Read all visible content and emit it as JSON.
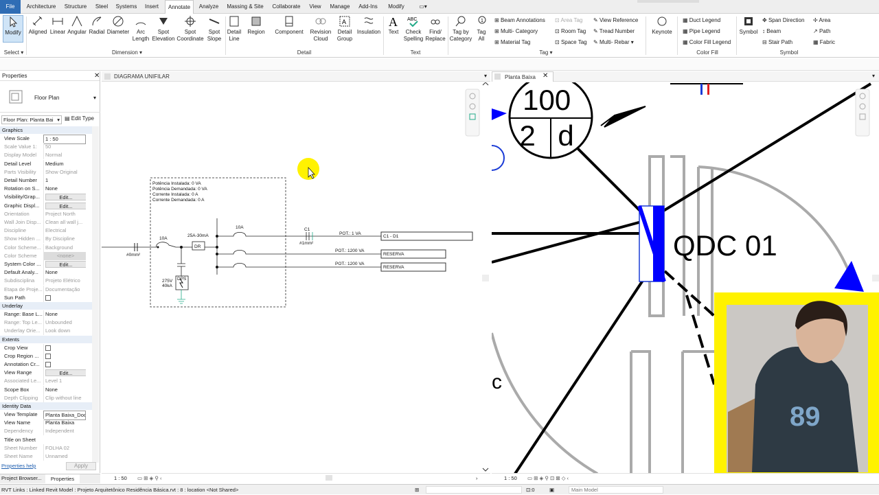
{
  "menu": {
    "file": "File",
    "tabs": [
      "Architecture",
      "Structure",
      "Steel",
      "Systems",
      "Insert",
      "Annotate",
      "Analyze",
      "Massing & Site",
      "Collaborate",
      "View",
      "Manage",
      "Add-Ins",
      "Modify"
    ],
    "active": "Annotate"
  },
  "ribbon": {
    "modify": "Modify",
    "select": "Select",
    "dimension_buttons": [
      "Aligned",
      "Linear",
      "Angular",
      "Radial",
      "Diameter",
      "Arc Length",
      "Spot Elevation",
      "Spot Coordinate",
      "Spot Slope"
    ],
    "dimension_group": "Dimension",
    "detail_buttons": [
      "Detail Line",
      "Region",
      "Component",
      "Revision Cloud",
      "Detail Group",
      "Insulation"
    ],
    "detail_group": "Detail",
    "text_buttons": [
      "Text",
      "Check Spelling",
      "Find/ Replace"
    ],
    "text_group": "Text",
    "tag_buttons": [
      "Tag by Category",
      "Tag All"
    ],
    "tag_small": [
      "Beam Annotations",
      "Multi- Category",
      "Material Tag",
      "Area Tag",
      "Room Tag",
      "Space Tag",
      "View Reference",
      "Tread Number",
      "Multi- Rebar"
    ],
    "tag_group": "Tag",
    "keynote": "Keynote",
    "colorfill_small": [
      "Duct Legend",
      "Pipe Legend",
      "Color Fill Legend"
    ],
    "colorfill_group": "Color Fill",
    "symbol": "Symbol",
    "symbol_small": [
      "Span Direction",
      "Beam",
      "Stair Path",
      "Area",
      "Path",
      "Fabric"
    ],
    "symbol_group": "Symbol"
  },
  "properties": {
    "title": "Properties",
    "type_name": "Floor Plan",
    "instance_selector": "Floor Plan: Planta Bai",
    "edit_type": "Edit Type",
    "categories": [
      "Graphics",
      "Underlay",
      "Extents",
      "Identity Data"
    ],
    "graphics": [
      [
        "View Scale",
        "1 : 50",
        0
      ],
      [
        "Scale Value 1:",
        "50",
        1
      ],
      [
        "Display Model",
        "Normal",
        1
      ],
      [
        "Detail Level",
        "Medium",
        0
      ],
      [
        "Parts Visibility",
        "Show Original",
        1
      ],
      [
        "Detail Number",
        "1",
        0
      ],
      [
        "Rotation on S...",
        "None",
        0
      ],
      [
        "Visibility/Grap...",
        "Edit...",
        0
      ],
      [
        "Graphic Displ...",
        "Edit...",
        0
      ],
      [
        "Orientation",
        "Project North",
        1
      ],
      [
        "Wall Join Disp...",
        "Clean all wall j...",
        1
      ],
      [
        "Discipline",
        "Electrical",
        1
      ],
      [
        "Show Hidden ...",
        "By Discipline",
        1
      ],
      [
        "Color Scheme...",
        "Background",
        1
      ],
      [
        "Color Scheme",
        "<none>",
        1
      ],
      [
        "System Color ...",
        "Edit...",
        0
      ],
      [
        "Default Analy...",
        "None",
        0
      ],
      [
        "Subdisciplina",
        "Projeto Elétrico",
        1
      ],
      [
        "Etapa de Proje...",
        "Documentação",
        1
      ],
      [
        "Sun Path",
        "",
        0
      ]
    ],
    "underlay": [
      [
        "Range: Base L...",
        "None",
        0
      ],
      [
        "Range: Top Le...",
        "Unbounded",
        1
      ],
      [
        "Underlay Orie...",
        "Look down",
        1
      ]
    ],
    "extents": [
      [
        "Crop View",
        "",
        0
      ],
      [
        "Crop Region ...",
        "",
        0
      ],
      [
        "Annotation Cr...",
        "",
        0
      ],
      [
        "View Range",
        "Edit...",
        0
      ],
      [
        "Associated Le...",
        "Level 1",
        1
      ],
      [
        "Scope Box",
        "None",
        0
      ],
      [
        "Depth Clipping",
        "Clip without line",
        1
      ]
    ],
    "identity": [
      [
        "View Template",
        "Planta Baixa_Doc",
        0
      ],
      [
        "View Name",
        "Planta Baixa",
        0
      ],
      [
        "Dependency",
        "Independent",
        1
      ],
      [
        "Title on Sheet",
        "",
        0
      ],
      [
        "Sheet Number",
        "FOLHA 02",
        1
      ],
      [
        "Sheet Name",
        "Unnamed",
        1
      ]
    ],
    "help": "Properties help",
    "apply": "Apply",
    "bottom_tabs": [
      "Project Browser...",
      "Properties"
    ]
  },
  "view_left": {
    "tab": "DIAGRAMA UNIFILAR",
    "scale": "1 : 50",
    "info": [
      "Potência Instalada: 0 VA",
      "Potência Demandada: 0 VA",
      "Corrente Instalada: 0 A",
      "Corrente Demandada: 0 A"
    ],
    "labels": {
      "main_breaker": "10A",
      "dr": "25A-30mA",
      "dr_box": "DR",
      "input_cable": "#0mm²",
      "breaker_c1": "10A",
      "c1": "C1",
      "cable_c1": "#1mm²",
      "dps_rating": "275V\n40kA",
      "dps": "DPS"
    },
    "circuits": [
      {
        "pot": "POT.: 1 VA",
        "name": "C1 - D1"
      },
      {
        "pot": "POT.: 1200 VA",
        "name": "RESERVA"
      },
      {
        "pot": "POT.: 1200 VA",
        "name": "RESERVA"
      }
    ]
  },
  "view_right": {
    "tab": "Planta Baixa",
    "scale": "1 : 50",
    "tag_top": "100",
    "tag_bl": "2",
    "tag_br": "d",
    "panel": "QDC 01",
    "letter": "c"
  },
  "status": {
    "text": "RVT Links : Linked Revit Model : Projeto Arquitetônico Residência Básica.rvt : 8 : location <Not Shared>",
    "zero": ":0",
    "model": "Main Model"
  },
  "colors": {
    "file_tab": "#2f6db5",
    "highlight": "#fff200",
    "panel_blue": "#0000ff",
    "webcam_border": "#fff200"
  }
}
